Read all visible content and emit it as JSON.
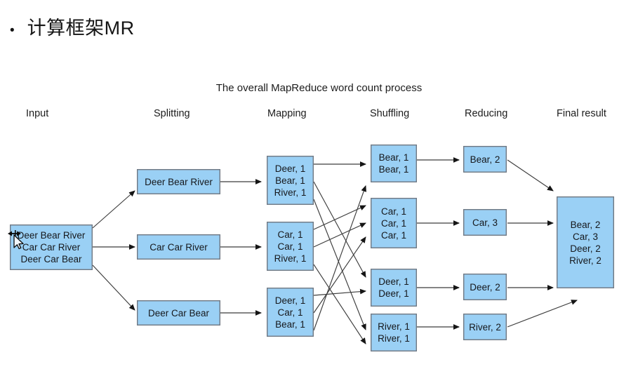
{
  "slide": {
    "bullet": "•",
    "title": "计算框架MR"
  },
  "diagram": {
    "title": "The overall MapReduce word count process",
    "accent_color": "#9AD0F5",
    "border_color": "#6e7883",
    "edge_color": "#3a3a3a",
    "headers": [
      {
        "label": "Input"
      },
      {
        "label": "Splitting"
      },
      {
        "label": "Mapping"
      },
      {
        "label": "Shuffling"
      },
      {
        "label": "Reducing"
      },
      {
        "label": "Final result"
      }
    ],
    "input": {
      "lines": [
        "Deer Bear River",
        "Car Car River",
        "Deer Car Bear"
      ]
    },
    "splitting": [
      {
        "lines": [
          "Deer Bear River"
        ]
      },
      {
        "lines": [
          "Car Car River"
        ]
      },
      {
        "lines": [
          "Deer Car Bear"
        ]
      }
    ],
    "mapping": [
      {
        "lines": [
          "Deer, 1",
          "Bear, 1",
          "River, 1"
        ]
      },
      {
        "lines": [
          "Car, 1",
          "Car, 1",
          "River, 1"
        ]
      },
      {
        "lines": [
          "Deer, 1",
          "Car, 1",
          "Bear, 1"
        ]
      }
    ],
    "shuffling": [
      {
        "lines": [
          "Bear, 1",
          "Bear, 1"
        ]
      },
      {
        "lines": [
          "Car, 1",
          "Car, 1",
          "Car, 1"
        ]
      },
      {
        "lines": [
          "Deer, 1",
          "Deer, 1"
        ]
      },
      {
        "lines": [
          "River, 1",
          "River, 1"
        ]
      }
    ],
    "reducing": [
      {
        "lines": [
          "Bear, 2"
        ]
      },
      {
        "lines": [
          "Car, 3"
        ]
      },
      {
        "lines": [
          "Deer, 2"
        ]
      },
      {
        "lines": [
          "River, 2"
        ]
      }
    ],
    "final": {
      "lines": [
        "Bear, 2",
        "Car, 3",
        "Deer, 2",
        "River, 2"
      ]
    }
  },
  "cursor": {
    "type": "horizontal-resize-pointer"
  }
}
